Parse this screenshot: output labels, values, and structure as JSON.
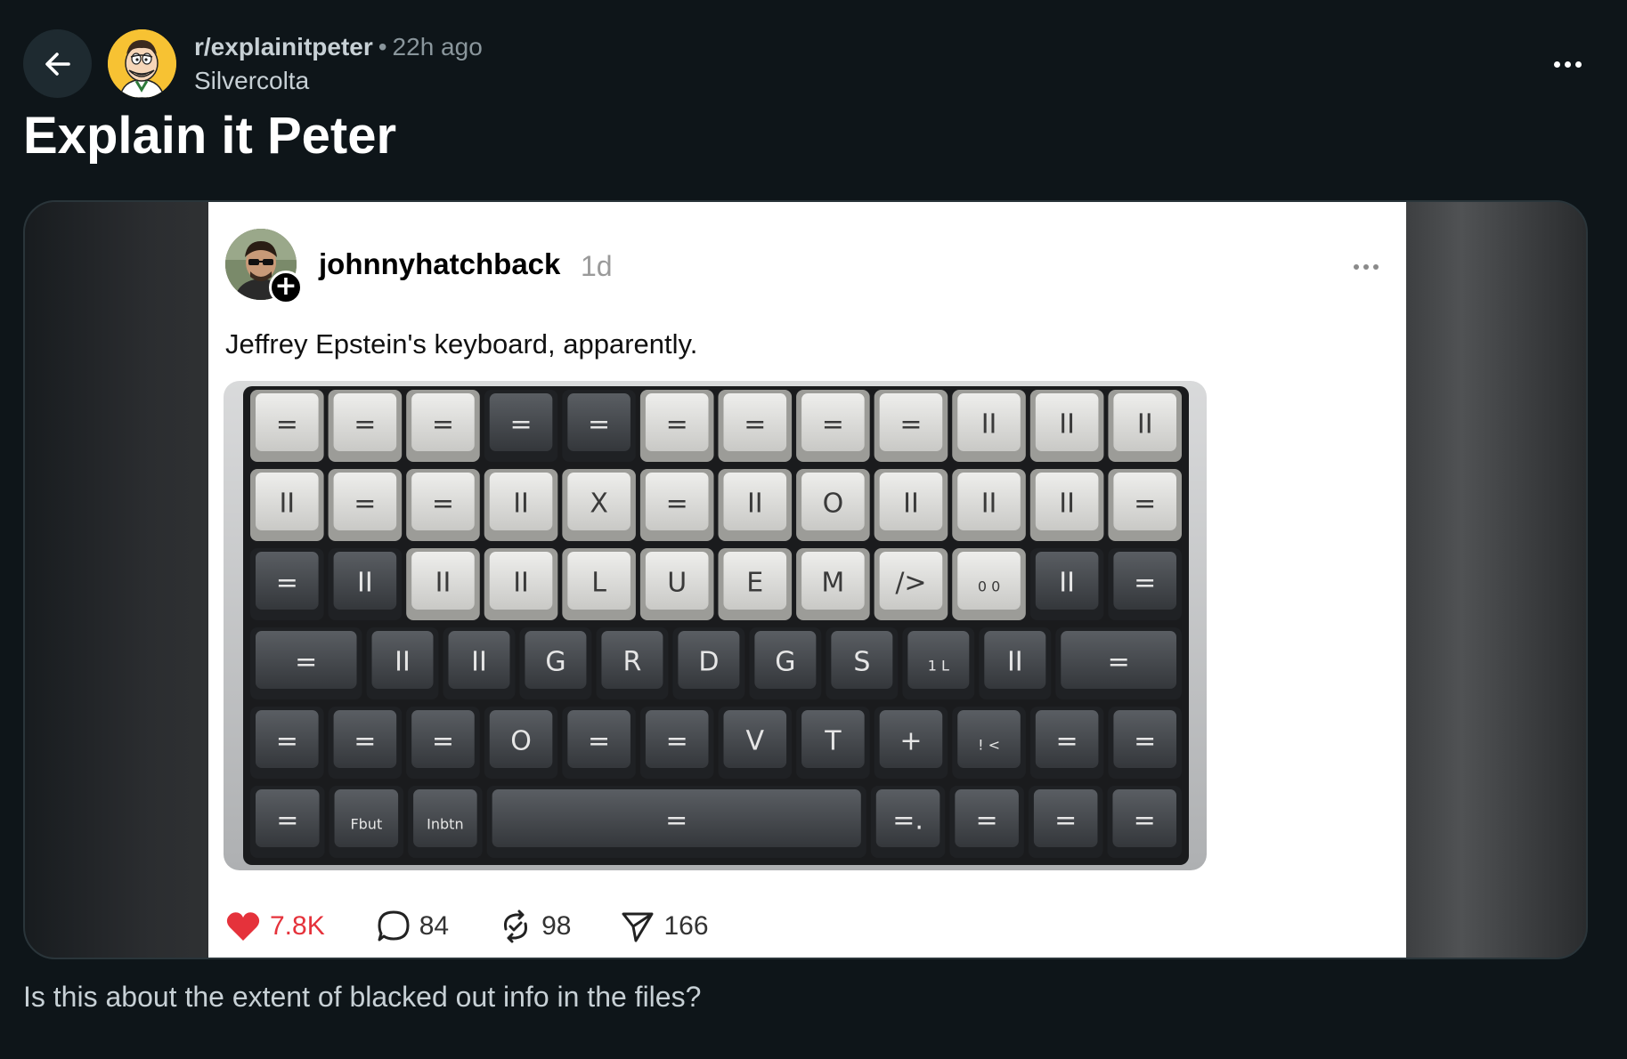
{
  "header": {
    "subreddit": "r/explainitpeter",
    "separator": "•",
    "time_ago": "22h ago",
    "username": "Silvercolta"
  },
  "post": {
    "title": "Explain it Peter",
    "body": "Is this about the extent of blacked out info in the files?"
  },
  "embedded_post": {
    "username": "johnnyhatchback",
    "age": "1d",
    "text": "Jeffrey Epstein's keyboard, apparently.",
    "stats": {
      "likes": "7.8K",
      "replies": "84",
      "reposts": "98",
      "shares": "166"
    },
    "like_color": "#e5323b"
  },
  "keyboard": {
    "rows": [
      [
        [
          "=",
          "l"
        ],
        [
          "=",
          "l"
        ],
        [
          "=",
          "l"
        ],
        [
          "=",
          "d"
        ],
        [
          "=",
          "d"
        ],
        [
          "=",
          "l"
        ],
        [
          "=",
          "l"
        ],
        [
          "=",
          "l"
        ],
        [
          "=",
          "l"
        ],
        [
          "II",
          "l"
        ],
        [
          "II",
          "l"
        ],
        [
          "II",
          "l"
        ]
      ],
      [
        [
          "II",
          "l"
        ],
        [
          "=",
          "l"
        ],
        [
          "=",
          "l"
        ],
        [
          "II",
          "l"
        ],
        [
          "X",
          "l"
        ],
        [
          "=",
          "l"
        ],
        [
          "II",
          "l"
        ],
        [
          "O",
          "l"
        ],
        [
          "II",
          "l"
        ],
        [
          "II",
          "l"
        ],
        [
          "II",
          "l"
        ],
        [
          "=",
          "l"
        ]
      ],
      [
        [
          "=",
          "d"
        ],
        [
          "II",
          "d"
        ],
        [
          "II",
          "l"
        ],
        [
          "II",
          "l"
        ],
        [
          "L",
          "l"
        ],
        [
          "U",
          "l"
        ],
        [
          "E",
          "l"
        ],
        [
          "M",
          "l"
        ],
        [
          "/>",
          "l"
        ],
        [
          "0 0",
          "l"
        ],
        [
          "II",
          "d"
        ],
        [
          "=",
          "d"
        ]
      ],
      [
        [
          "=",
          "d",
          1.55
        ],
        [
          "II",
          "d"
        ],
        [
          "II",
          "d"
        ],
        [
          "G",
          "d"
        ],
        [
          "R",
          "d"
        ],
        [
          "D",
          "d"
        ],
        [
          "G",
          "d"
        ],
        [
          "S",
          "d"
        ],
        [
          "1 L",
          "d"
        ],
        [
          "II",
          "d"
        ],
        [
          "=",
          "d",
          1.75
        ]
      ],
      [
        [
          "=",
          "d"
        ],
        [
          "=",
          "d"
        ],
        [
          "=",
          "d"
        ],
        [
          "O",
          "d"
        ],
        [
          "=",
          "d"
        ],
        [
          "=",
          "d"
        ],
        [
          "V",
          "d"
        ],
        [
          "T",
          "d"
        ],
        [
          "+",
          "d"
        ],
        [
          "! <",
          "d"
        ],
        [
          "=",
          "d"
        ],
        [
          "=",
          "d"
        ]
      ],
      [
        [
          "=",
          "d"
        ],
        [
          "Fbut",
          "d"
        ],
        [
          "Inbtn",
          "d"
        ],
        [
          "=",
          "d",
          5.1
        ],
        [
          "=.",
          "d"
        ],
        [
          "=",
          "d"
        ],
        [
          "=",
          "d"
        ],
        [
          "=",
          "d"
        ]
      ]
    ]
  },
  "colors": {
    "background": "#0e1519",
    "accent_text": "#c7d0d5",
    "muted_text": "#8a969c"
  },
  "icons": {
    "back": "arrow-left-icon",
    "overflow": "more-horizontal-icon",
    "like": "heart-icon",
    "reply": "comment-bubble-icon",
    "repost": "repost-arrows-icon",
    "share": "send-paper-plane-icon"
  }
}
